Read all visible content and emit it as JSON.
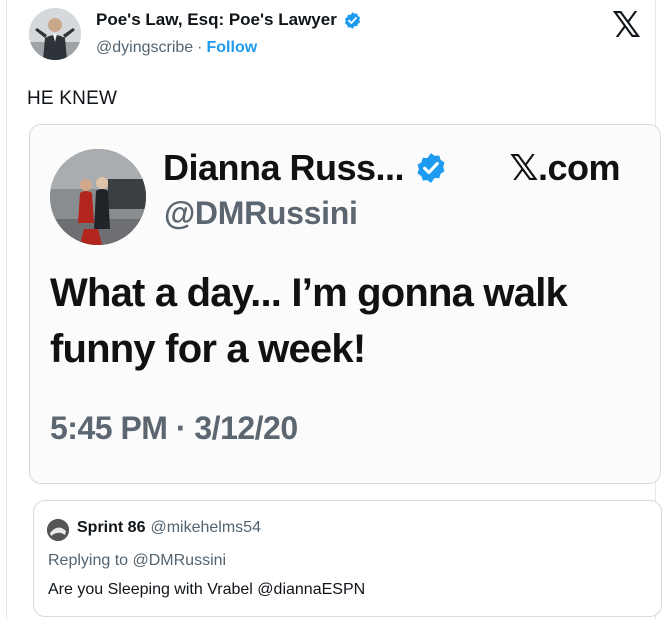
{
  "tweet": {
    "author_name": "Poe's Law, Esq: Poe's Lawyer",
    "author_handle": "@dyingscribe",
    "separator": "·",
    "follow_label": "Follow",
    "brand_logo": "𝕏",
    "text": "HE KNEW"
  },
  "embedded_screenshot": {
    "name": "Dianna Russ...",
    "brand": "𝕏.com",
    "handle": "@DMRussini",
    "text": "What a day... I’m gonna walk funny for a week!",
    "timestamp": "5:45 PM · 3/12/20"
  },
  "reply": {
    "name": "Sprint 86",
    "handle": "@mikehelms54",
    "replying_to": "Replying to @DMRussini",
    "text": "Are you Sleeping with Vrabel @diannaESPN"
  },
  "icons": {
    "verified_badge": "verified-icon",
    "x_logo": "x-logo-icon"
  },
  "colors": {
    "accent": "#1d9bf0",
    "secondary_text": "#536471",
    "primary_text": "#0f1419"
  }
}
